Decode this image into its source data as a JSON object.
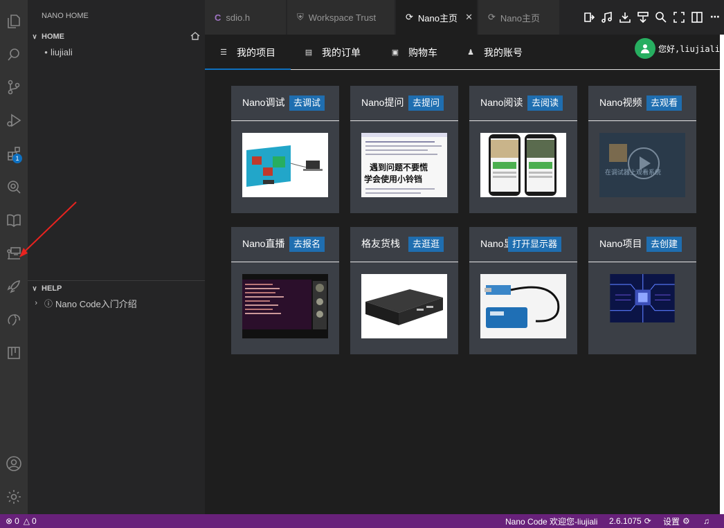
{
  "colors": {
    "accent": "#0e70c0",
    "statusbar": "#68217a",
    "card_button": "#1f6eb0",
    "avatar": "#27ae60",
    "annotation_arrow": "#e8231f"
  },
  "activitybar": {
    "icons": [
      "explorer-icon",
      "search-icon",
      "source-control-icon",
      "run-debug-icon",
      "extensions-icon",
      "nano-search-icon",
      "book-icon",
      "nano-home-icon",
      "rocket-icon",
      "nano-logo-icon",
      "board-icon",
      "account-icon",
      "settings-gear-icon"
    ],
    "extensions_badge": "1"
  },
  "sidebar": {
    "title": "NANO HOME",
    "home_section": "HOME",
    "home_items": [
      "liujiali"
    ],
    "help_section": "HELP",
    "help_items": [
      "Nano Code入门介绍"
    ]
  },
  "tabs": [
    {
      "label": "sdio.h",
      "icon": "C"
    },
    {
      "label": "Workspace Trust",
      "icon": "shield-icon"
    },
    {
      "label": "Nano主页",
      "icon": "nano-icon",
      "active": true
    },
    {
      "label": "Nano主页",
      "icon": "nano-icon"
    }
  ],
  "editor_actions": [
    "import-icon",
    "music-icon",
    "download-tray-icon",
    "burn-icon",
    "zoom-icon",
    "fullscreen-icon",
    "split-editor-icon",
    "more-icon"
  ],
  "webview": {
    "nav": [
      {
        "label": "我的项目",
        "icon": "menu-icon"
      },
      {
        "label": "我的订单",
        "icon": "document-icon"
      },
      {
        "label": "购物车",
        "icon": "cart-icon"
      },
      {
        "label": "我的账号",
        "icon": "person-icon"
      }
    ],
    "greeting": "您好,liujiali",
    "cards": [
      {
        "title": "Nano调试",
        "button": "去调试",
        "image": "hardware-diagram"
      },
      {
        "title": "Nano提问",
        "button": "去提问",
        "image": "question-forum-screenshot",
        "image_text": [
          "遇到问题不要慌",
          "学会使用小铃铛"
        ]
      },
      {
        "title": "Nano阅读",
        "button": "去阅读",
        "image": "phones"
      },
      {
        "title": "Nano视频",
        "button": "去观看",
        "image": "video-thumbnail",
        "image_text": [
          "在调试器上观看系统"
        ]
      },
      {
        "title": "Nano直播",
        "button": "去报名",
        "image": "live-screen"
      },
      {
        "title": "格友货栈",
        "button": "去逛逛",
        "image": "device-box"
      },
      {
        "title": "Nano显",
        "button": "打开显示器",
        "image": "hdmi-capture"
      },
      {
        "title": "Nano项目",
        "button": "去创建",
        "image": "circuit-board"
      }
    ]
  },
  "statusbar": {
    "errors": "0",
    "warnings": "0",
    "welcome": "Nano Code 欢迎您-liujiali",
    "version": "2.6.1075",
    "settings": "设置"
  }
}
